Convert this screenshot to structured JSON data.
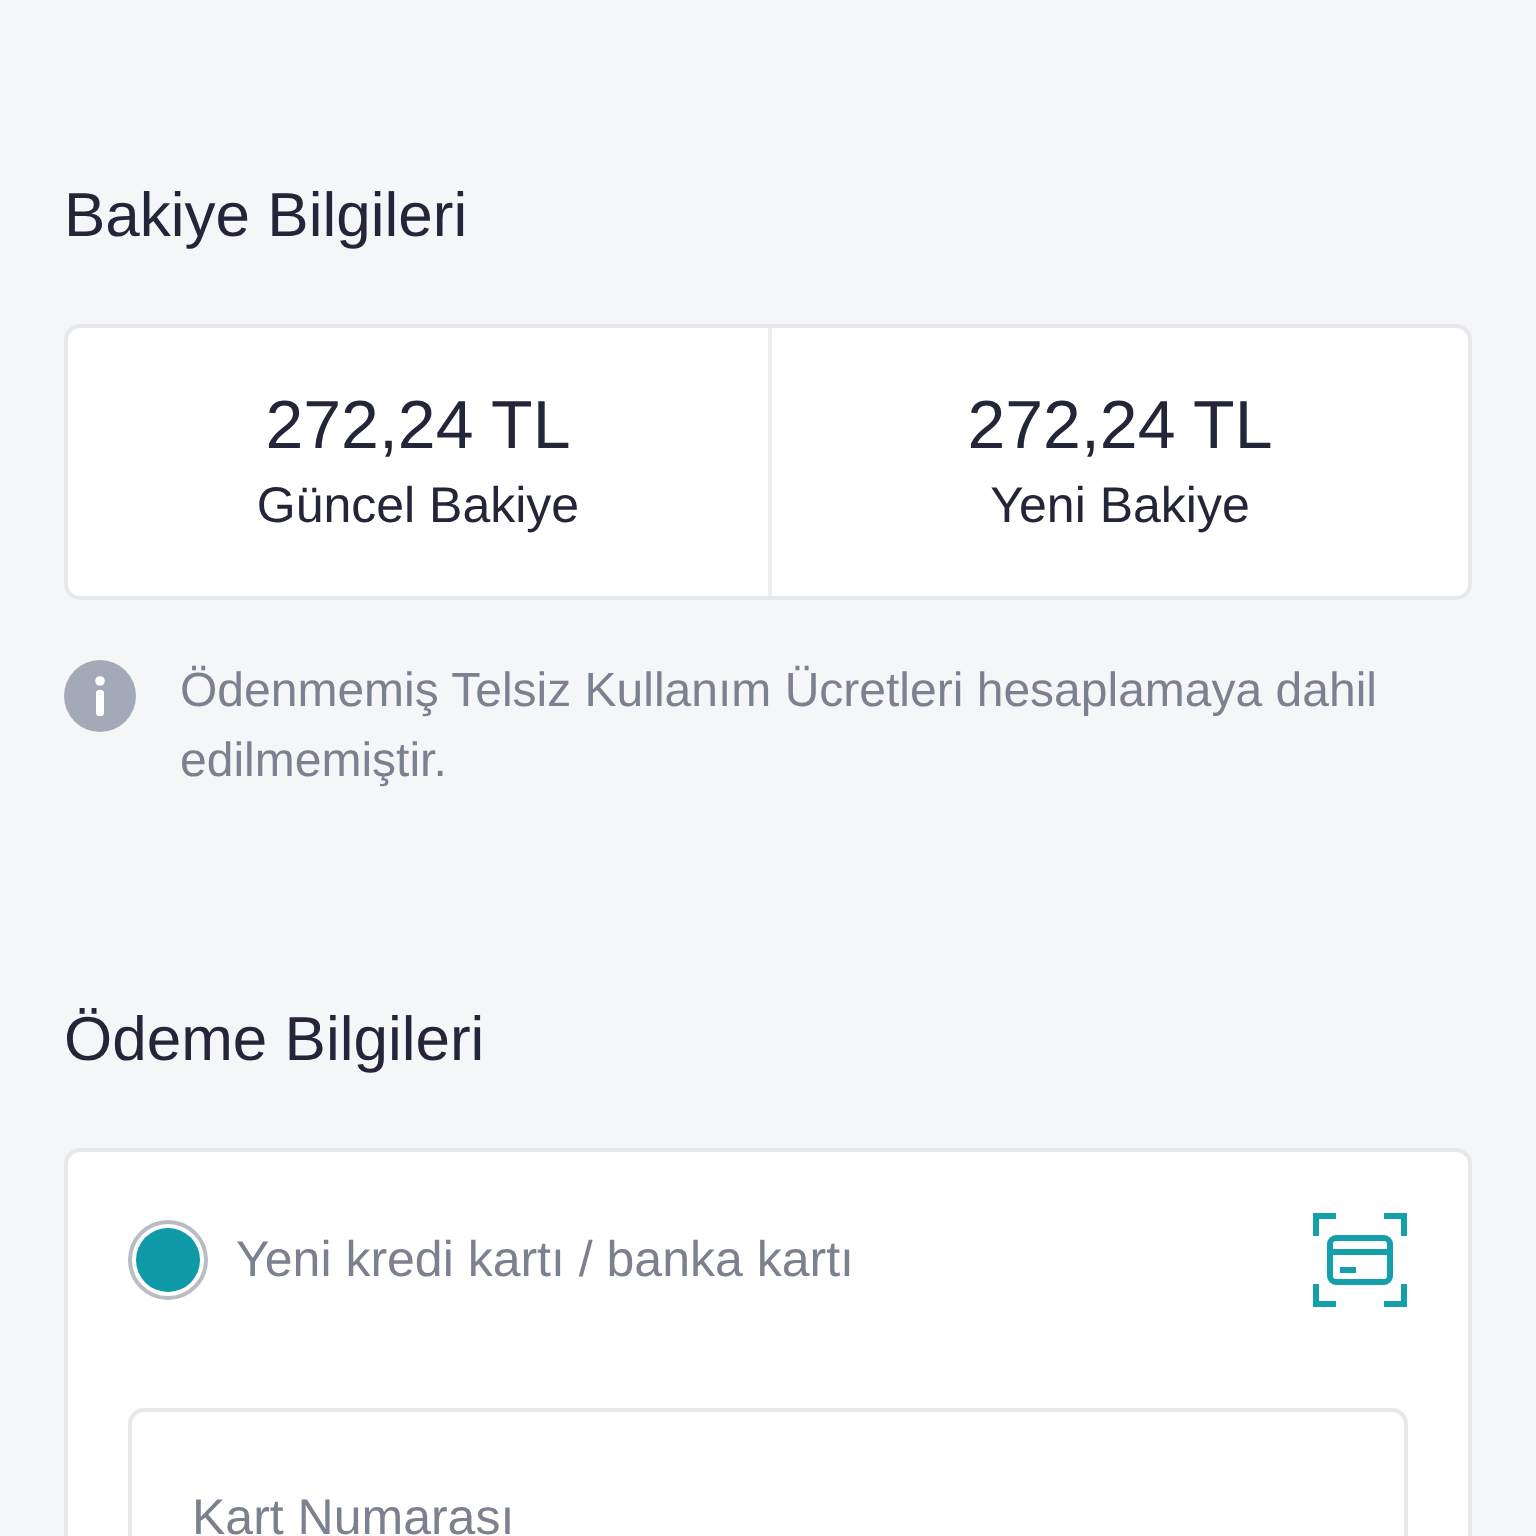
{
  "balance_section": {
    "title": "Bakiye Bilgileri",
    "items": [
      {
        "amount": "272,24 TL",
        "label": "Güncel Bakiye"
      },
      {
        "amount": "272,24 TL",
        "label": "Yeni Bakiye"
      }
    ],
    "note": "Ödenmemiş Telsiz Kullanım Ücretleri hesaplamaya dahil edilmemiştir."
  },
  "payment_section": {
    "title": "Ödeme Bilgileri",
    "options": [
      {
        "label": "Yeni kredi kartı / banka kartı",
        "selected": true
      }
    ],
    "card_number": {
      "placeholder": "Kart Numarası"
    }
  }
}
